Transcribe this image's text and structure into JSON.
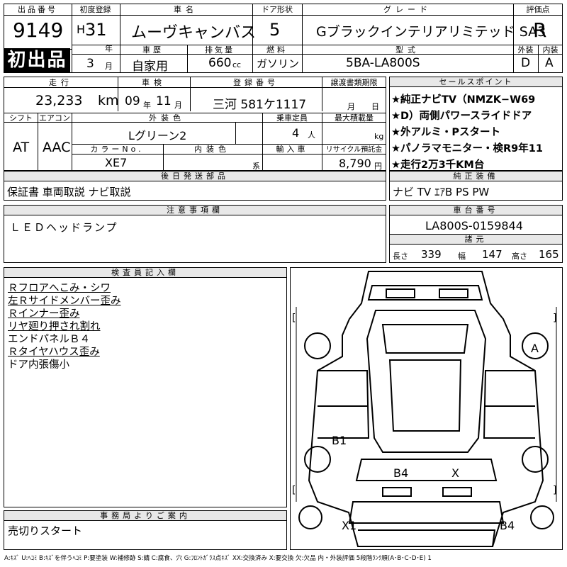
{
  "header": {
    "lot_no_label": "出品番号",
    "lot_no": "9149",
    "first_listing": "初出品",
    "first_reg_label": "初度登録",
    "era": "H",
    "year": "31",
    "year_unit": "年",
    "month": "3",
    "month_unit": "月",
    "car_name_label": "車名",
    "car_name": "ムーヴキャンバス",
    "door_label": "ドア形状",
    "doors": "5",
    "grade_label": "グレード",
    "grade": "Gブラックインテリアリミテッド SA3",
    "rating_label": "評価点",
    "rating": "R",
    "history_label": "車歴",
    "history": "自家用",
    "displacement_label": "排気量",
    "displacement": "660",
    "displacement_unit": "cc",
    "fuel_label": "燃料",
    "fuel": "ガソリン",
    "model_label": "型式",
    "model": "5BA-LA800S",
    "exterior_label": "外装",
    "exterior": "D",
    "interior_label": "内装",
    "interior": "A"
  },
  "row2": {
    "mileage_label": "走行",
    "mileage": "23,233",
    "mileage_unit": "km",
    "inspection_label": "車検",
    "insp_year": "09",
    "insp_year_unit": "年",
    "insp_month": "11",
    "insp_month_unit": "月",
    "plate_label": "登録番号",
    "plate": "三河 581ケ1117",
    "transfer_label": "譲渡書類期限",
    "transfer_month_unit": "月",
    "transfer_day_unit": "日",
    "shift_label": "シフト",
    "shift": "AT",
    "ac_label": "エアコン",
    "ac": "AAC",
    "ext_color_label": "外装色",
    "ext_color": "Lグリーン2",
    "capacity_label": "乗車定員",
    "capacity": "4",
    "capacity_unit": "人",
    "max_load_label": "最大積載量",
    "max_load_unit": "kg",
    "color_no_label": "カラーNo.",
    "color_no": "XE7",
    "int_color_label": "内装色",
    "int_color_unit": "系",
    "import_label": "輸入車",
    "recycle_label": "リサイクル預託金",
    "recycle": "8,790",
    "recycle_unit": "円"
  },
  "sales_points": {
    "label": "セールスポイント",
    "items": [
      "★純正ナビTV（NMZK−W69",
      "★D）両側パワースライドドア",
      "★外アルミ・Pスタート",
      "★パノラマモニター・検R9年11",
      "★走行2万3千KM台"
    ]
  },
  "equipment": {
    "label": "純正装備",
    "value": "ナビ TV ｴｱB PS PW"
  },
  "delivery": {
    "label": "後日発送部品",
    "value": "保証書 車両取説 ナビ取説"
  },
  "notes": {
    "label": "注意事項欄",
    "value": "ＬＥＤヘッドランプ"
  },
  "chassis": {
    "label": "車台番号",
    "value": "LA800S-0159844",
    "dims_label": "諸元",
    "length_label": "長さ",
    "length": "339",
    "width_label": "幅",
    "width": "147",
    "height_label": "高さ",
    "height": "165"
  },
  "inspector": {
    "label": "検査員記入欄",
    "lines": [
      "Ｒフロアへこみ・シワ",
      "左Ｒサイドメンバー歪み",
      "Ｒインナー歪み",
      "リヤ廻り押され割れ",
      "エンドパネルＢ４",
      "Ｒタイヤハウス歪み",
      "ドア内張傷小"
    ]
  },
  "office": {
    "label": "事務局よりご案内",
    "value": "売切りスタート"
  },
  "diagram": {
    "marks": [
      "A",
      "B1",
      "B4",
      "X",
      "X1",
      "B4"
    ],
    "brackets": [
      "[",
      "]",
      "[",
      "]",
      "[",
      "]",
      "[",
      "]"
    ]
  },
  "legend": "A:ｷｽﾞ U:ﾍｺﾐ B:ｷｽﾞを伴うﾍｺﾐ P:要塗装 W:補修跡 S:錆 C:腐食、穴 G:ﾌﾛﾝﾄｶﾞﾗｽ点ｷｽﾞ XX:交換済み X:要交換 欠:欠品 内・外装評価 5段階ﾗﾝｸ順(A･B･C･D･E) 1"
}
